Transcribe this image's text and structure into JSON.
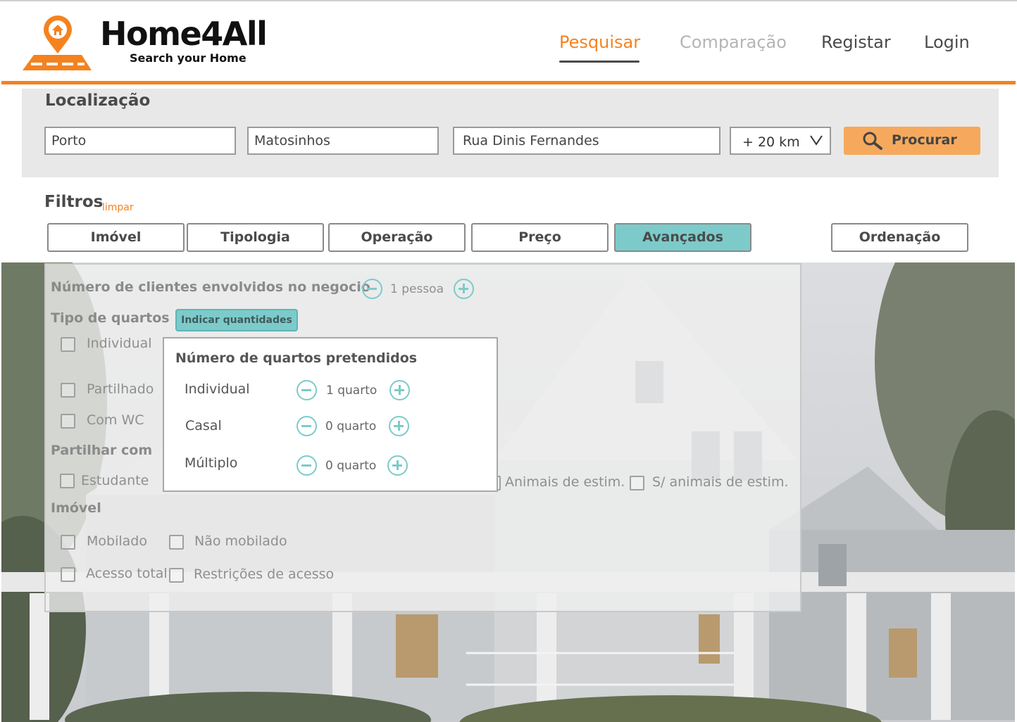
{
  "header": {
    "brand": "Home4All",
    "tagline": "Search your Home",
    "nav": [
      "Pesquisar",
      "Comparação",
      "Registar",
      "Login"
    ],
    "colors": {
      "accent": "#f5821f",
      "teal": "#7ccbca"
    }
  },
  "location": {
    "title": "Localização",
    "district": "Porto",
    "municipality": "Matosinhos",
    "street": "Rua Dinis Fernandes",
    "radius": "+ 20 km",
    "search_label": "Procurar"
  },
  "filters": {
    "title": "Filtros",
    "clear": "limpar",
    "tabs": [
      "Imóvel",
      "Tipologia",
      "Operação",
      "Preço",
      "Avançados"
    ],
    "sort": "Ordenação",
    "active_tab": "Avançados"
  },
  "advanced": {
    "clients_label": "Número de clientes envolvidos no negocio",
    "clients_value": "1 pessoa",
    "room_types_label": "Tipo de quartos",
    "quantities_button": "Indicar quantidades",
    "room_types": [
      "Individual",
      "Partilhado",
      "Com WC"
    ],
    "share_label": "Partilhar com",
    "share_options": [
      "Estudante",
      "Animais de estim.",
      "S/ animais de estim."
    ],
    "property_label": "Imóvel",
    "property_options": [
      "Mobilado",
      "Não mobilado",
      "Acesso total",
      "Restrições de acesso"
    ]
  },
  "popup": {
    "title": "Número de quartos pretendidos",
    "rows": [
      {
        "label": "Individual",
        "value": "1 quarto"
      },
      {
        "label": "Casal",
        "value": "0 quarto"
      },
      {
        "label": "Múltiplo",
        "value": "0 quarto"
      }
    ]
  },
  "icons": [
    "map-pin-house-icon",
    "search-icon",
    "chevron-down-icon",
    "minus-circle-icon",
    "plus-circle-icon"
  ]
}
